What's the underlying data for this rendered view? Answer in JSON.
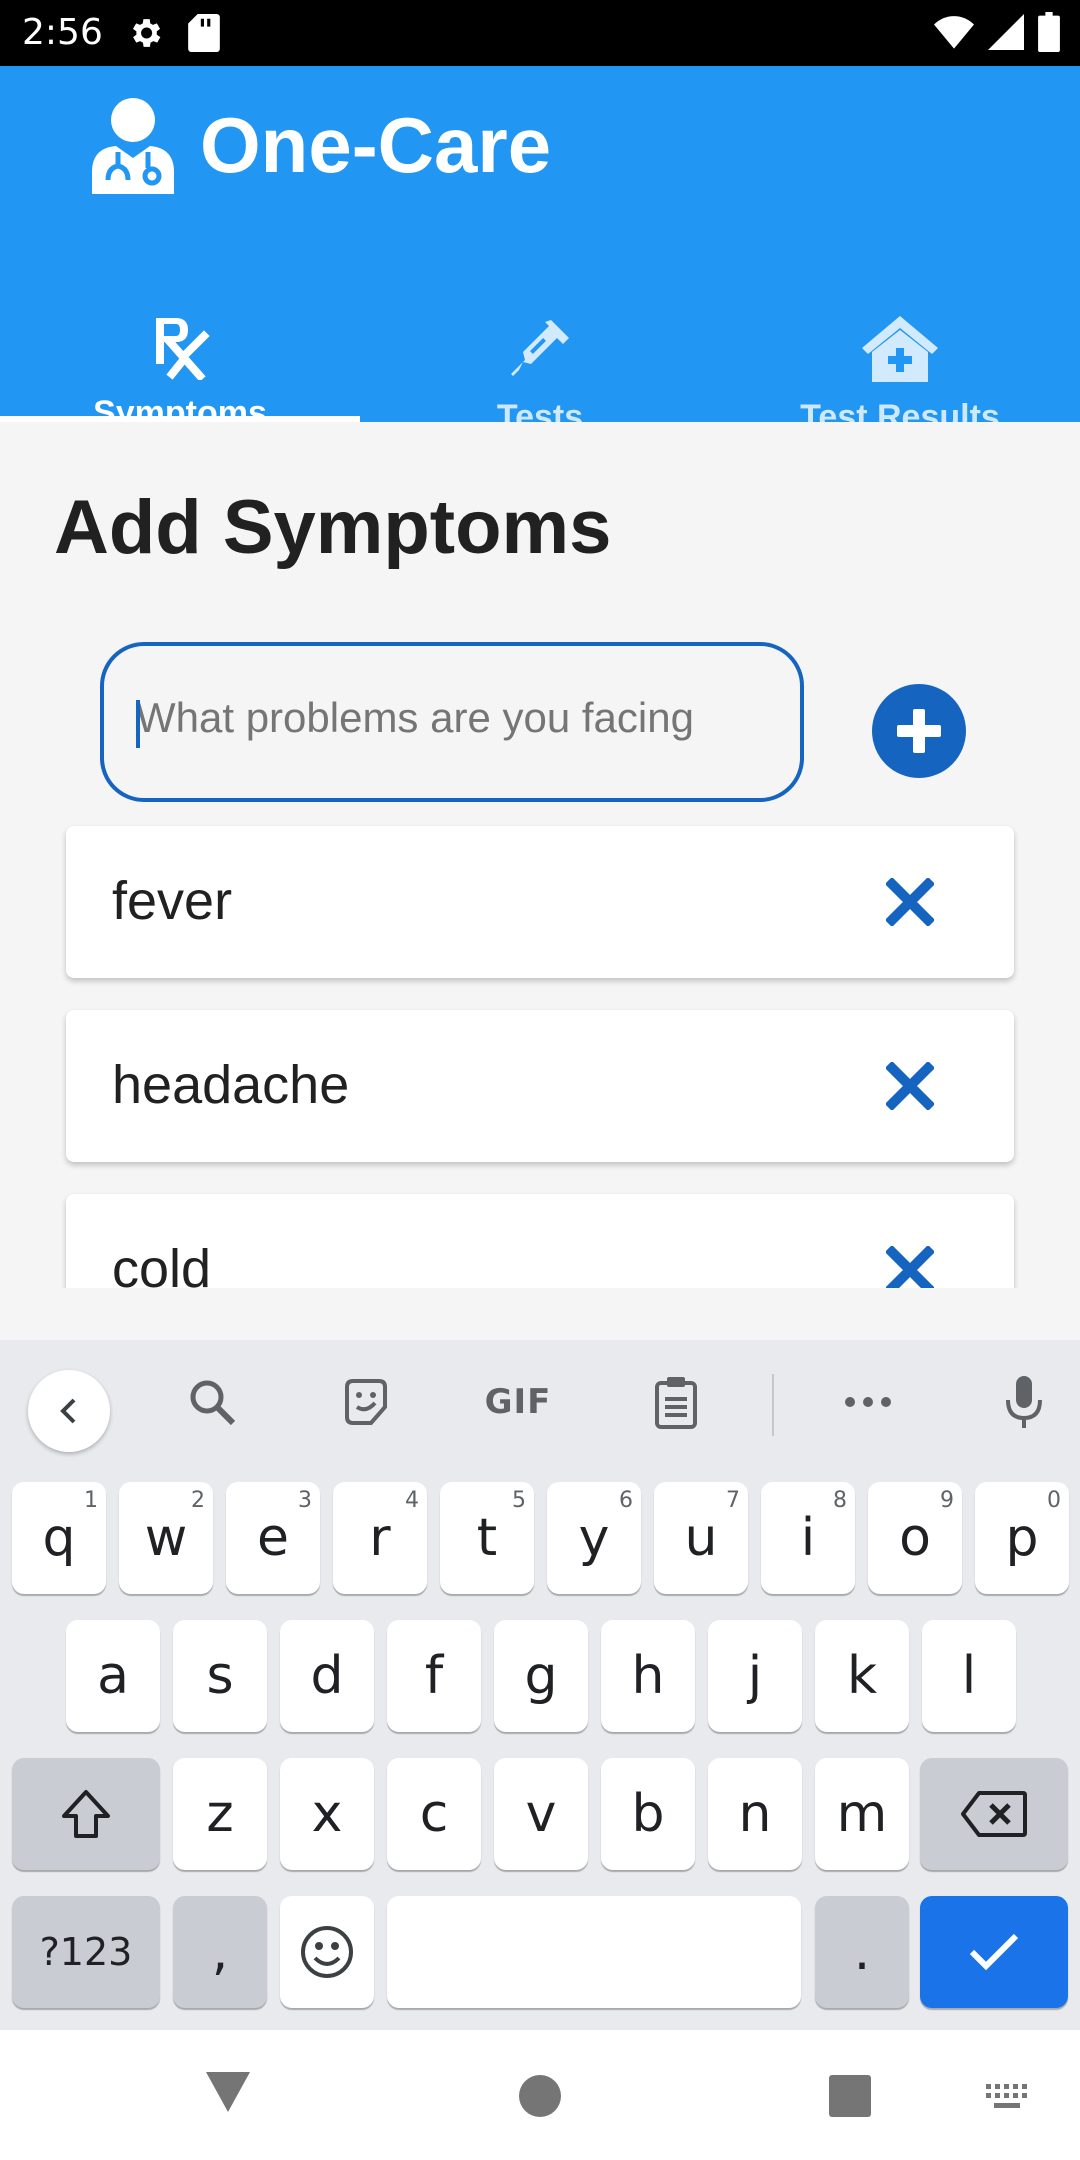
{
  "status_bar": {
    "time": "2:56",
    "left_icons": [
      "gear-icon",
      "sd-card-icon"
    ],
    "right_icons": [
      "wifi-icon",
      "cell-signal-icon",
      "battery-icon"
    ]
  },
  "app": {
    "title": "One-Care",
    "brand_color": "#2196f3",
    "accent_color": "#1565c0"
  },
  "tabs": [
    {
      "label": "Symptoms",
      "icon": "rx-icon",
      "active": true
    },
    {
      "label": "Tests",
      "icon": "syringe-icon",
      "active": false
    },
    {
      "label": "Test Results",
      "icon": "hospital-icon",
      "active": false
    }
  ],
  "main": {
    "heading": "Add Symptoms",
    "input": {
      "placeholder": "What problems are you facing",
      "value": ""
    },
    "symptoms": [
      "fever",
      "headache",
      "cold"
    ]
  },
  "keyboard": {
    "toolbar": [
      "chevron-left-icon",
      "search-icon",
      "sticker-icon",
      "GIF",
      "clipboard-icon",
      "more-icon",
      "mic-icon"
    ],
    "row1": [
      {
        "key": "q",
        "hint": "1"
      },
      {
        "key": "w",
        "hint": "2"
      },
      {
        "key": "e",
        "hint": "3"
      },
      {
        "key": "r",
        "hint": "4"
      },
      {
        "key": "t",
        "hint": "5"
      },
      {
        "key": "y",
        "hint": "6"
      },
      {
        "key": "u",
        "hint": "7"
      },
      {
        "key": "i",
        "hint": "8"
      },
      {
        "key": "o",
        "hint": "9"
      },
      {
        "key": "p",
        "hint": "0"
      }
    ],
    "row2": [
      "a",
      "s",
      "d",
      "f",
      "g",
      "h",
      "j",
      "k",
      "l"
    ],
    "row3": [
      "z",
      "x",
      "c",
      "v",
      "b",
      "n",
      "m"
    ],
    "row4": {
      "symbols": "?123",
      "comma": ",",
      "period": "."
    }
  },
  "nav_bar": [
    "back-icon",
    "home-icon",
    "recents-icon",
    "keyboard-switch-icon"
  ]
}
